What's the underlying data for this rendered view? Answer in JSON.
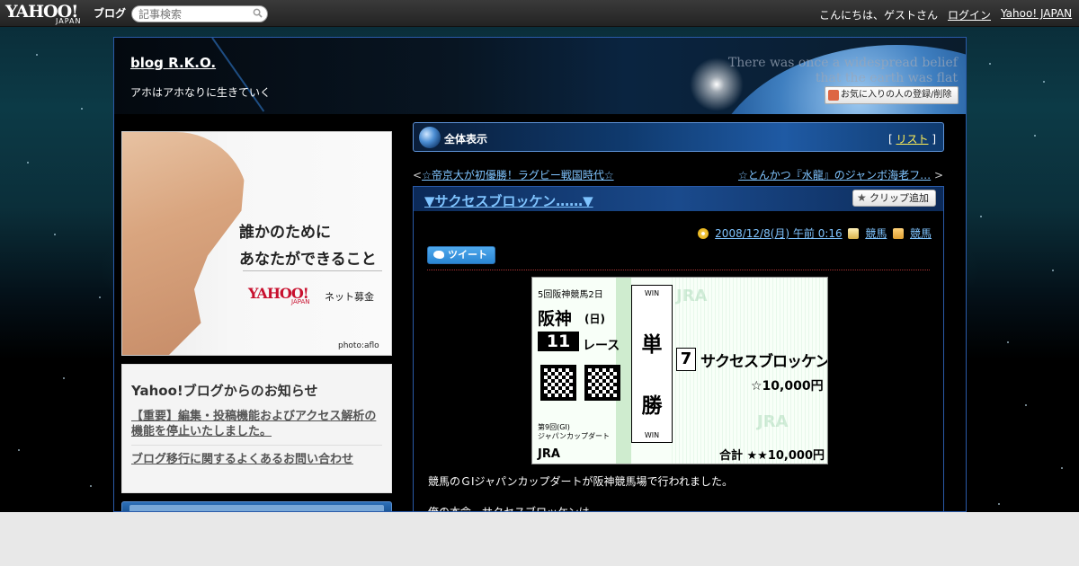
{
  "topbar": {
    "logo_text": "YAHOO!",
    "logo_sub": "JAPAN",
    "logo_blog": "ブログ",
    "search_placeholder": "記事検索",
    "greeting": "こんにちは、ゲストさん",
    "login": "ログイン",
    "yahoo_japan": "Yahoo! JAPAN"
  },
  "blog": {
    "title": "blog R.K.O.",
    "description": "アホはアホなりに生きていく",
    "header_motto_1": "There was once a widespread belief",
    "header_motto_2": "that the earth was flat",
    "fav_button": "お気に入りの人の登録/削除"
  },
  "ad": {
    "line1": "誰かのために",
    "line2": "あなたができること",
    "logo": "YAHOO!",
    "logo_sub": "JAPAN",
    "service": "ネット募金",
    "photo_credit": "photo:aflo"
  },
  "notice": {
    "heading": "Yahoo!ブログからのお知らせ",
    "items": [
      "【重要】編集・投稿機能およびアクセス解析の機能を停止いたしました。",
      "ブログ移行に関するよくあるお問い合わせ"
    ]
  },
  "view_bar": {
    "title": "全体表示",
    "list_label": "リスト"
  },
  "nav": {
    "prev": "☆帝京大が初優勝！ラグビー戦国時代☆",
    "next": "☆とんかつ『水龍』のジャンボ海老フ…",
    "prev_arrow": "<",
    "next_arrow": ">"
  },
  "post": {
    "title": "▼サクセスブロッケン……▼",
    "clip_button": "クリップ追加",
    "date": "2008/12/8(月) 午前 0:16",
    "category": "競馬",
    "folder": "競馬",
    "tweet_button": "ツイート",
    "body_line1": "競馬のＧⅠジャパンカップダートが阪神競馬場で行われました。",
    "body_line2": "俺の本命　サクセスブロッケンは"
  },
  "ticket": {
    "meeting": "5回阪神競馬2日",
    "venue": "阪神",
    "day": "(日)",
    "race_no": "11",
    "race_label": "レース",
    "grade_line1": "第9回(GI)",
    "grade_line2": "ジャパンカップダート",
    "jra": "JRA",
    "bet_kanji_1": "単",
    "bet_kanji_2": "勝",
    "win_label": "WIN",
    "horse_number": "7",
    "horse_name": "サクセスブロッケン",
    "amount": "☆10,000円",
    "total": "合計 ★★10,000円"
  },
  "colors": {
    "link": "#7fc4ff",
    "list_link": "#ffee55",
    "frame_border": "#2a5aa8"
  }
}
